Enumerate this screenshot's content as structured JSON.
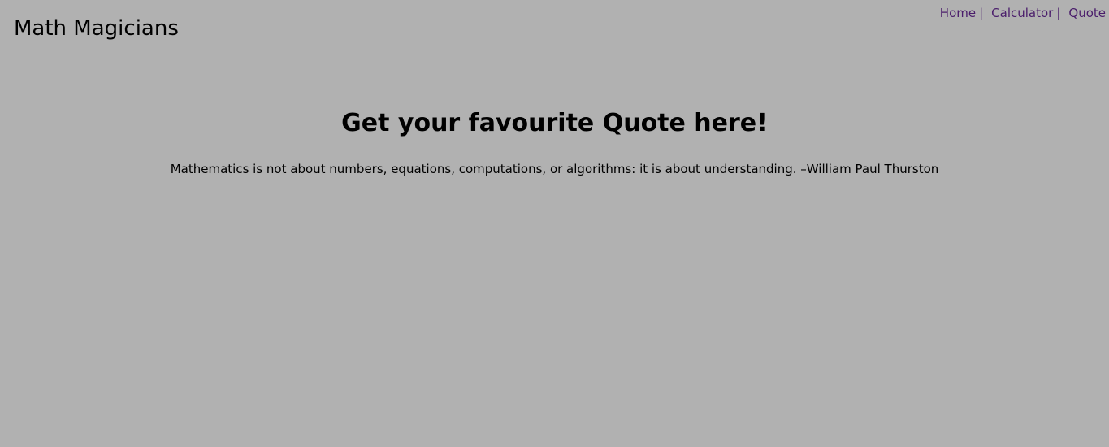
{
  "header": {
    "brand": "Math Magicians",
    "nav": {
      "home_label": "Home",
      "calculator_label": "Calculator",
      "quote_label": "Quote",
      "separator": "|"
    }
  },
  "main": {
    "heading": "Get your favourite Quote here!",
    "quote": "Mathematics is not about numbers, equations, computations, or algorithms: it is about understanding. –William Paul Thurston"
  },
  "colors": {
    "background": "#b1b1b1",
    "text": "#000000",
    "nav_link": "#4a1d6b"
  }
}
